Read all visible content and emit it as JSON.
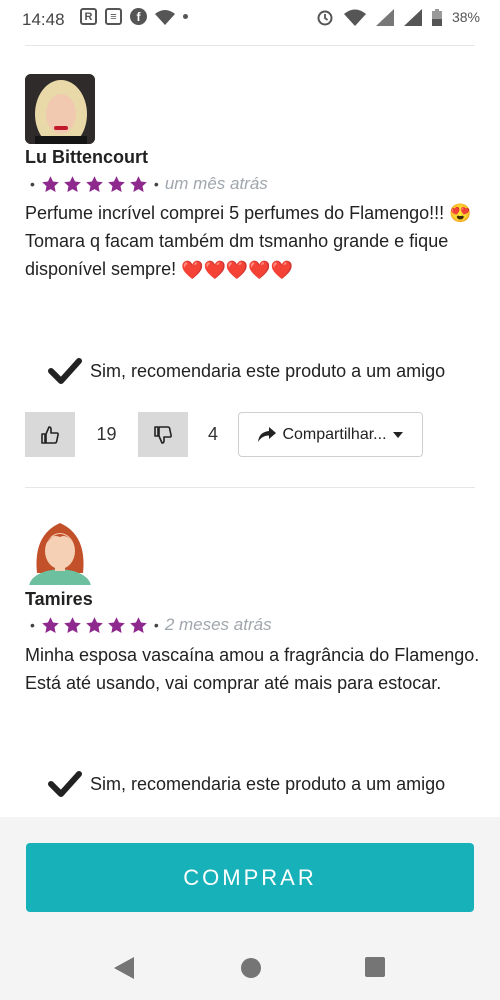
{
  "status_bar": {
    "time": "14:48",
    "battery": "38%",
    "fb_glyph": "f",
    "r_glyph": "R"
  },
  "reviews": [
    {
      "name": "Lu Bittencourt",
      "stars": 5,
      "time_ago": "um mês atrás",
      "text": "Perfume incrível comprei 5 perfumes do Flamengo!!! 😍 Tomara q facam também dm tsmanho grande e fique disponível sempre! ",
      "hearts": "❤️❤️❤️❤️❤️",
      "recommend_text": "Sim, recomendaria este produto a um amigo",
      "upvotes": "19",
      "downvotes": "4",
      "share_label": "Compartilhar..."
    },
    {
      "name": "Tamires",
      "stars": 5,
      "time_ago": "2 meses atrás",
      "text": "Minha esposa vascaína amou a fragrância do Flamengo. Está até usando, vai comprar até mais para estocar.",
      "recommend_text": "Sim, recomendaria este produto a um amigo"
    }
  ],
  "buy_button": "COMPRAR",
  "colors": {
    "star": "#8e2a8e",
    "buy_button": "#17b1b9",
    "time_text": "#a0a6ad"
  },
  "icons": [
    "thumbs-up-icon",
    "thumbs-down-icon",
    "share-icon",
    "caret-down-icon",
    "checkmark-icon",
    "back-icon",
    "home-icon",
    "recents-icon"
  ]
}
